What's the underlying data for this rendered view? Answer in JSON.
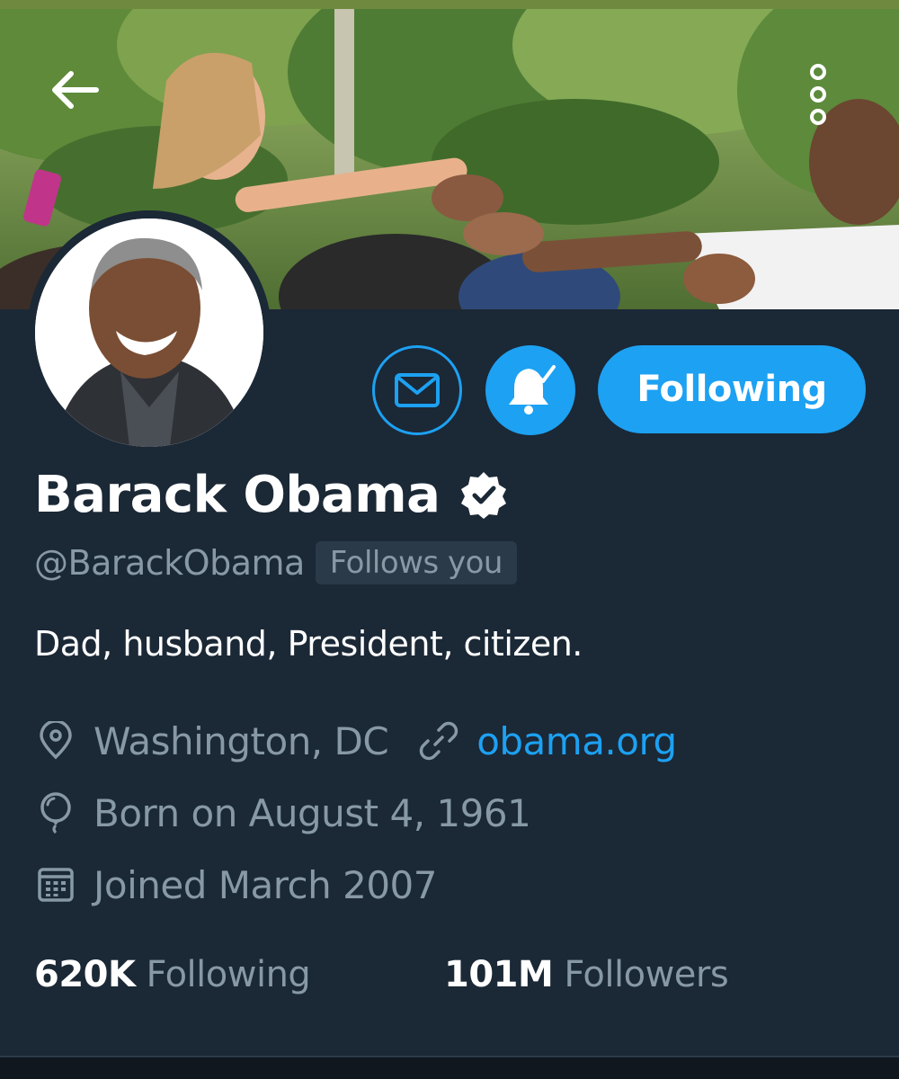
{
  "profile": {
    "name": "Barack Obama",
    "handle": "@BarackObama",
    "follows_you": "Follows you",
    "bio": "Dad, husband, President, citizen.",
    "location": "Washington, DC",
    "website": "obama.org",
    "birthday": "Born on August 4, 1961",
    "joined": "Joined March 2007"
  },
  "stats": {
    "following_count": "620K",
    "following_label": "Following",
    "followers_count": "101M",
    "followers_label": "Followers"
  },
  "actions": {
    "follow_button_label": "Following"
  },
  "icons": {
    "back": "arrow-left-icon",
    "more": "more-vertical-icon",
    "message": "envelope-icon",
    "notifications": "bell-check-icon",
    "verified": "verified-badge-icon",
    "location": "map-pin-icon",
    "link": "link-icon",
    "birthday": "balloon-icon",
    "calendar": "calendar-icon"
  },
  "colors": {
    "background": "#1b2836",
    "accent": "#1da1f2",
    "secondary_text": "#8899a6",
    "primary_text": "#ffffff"
  }
}
